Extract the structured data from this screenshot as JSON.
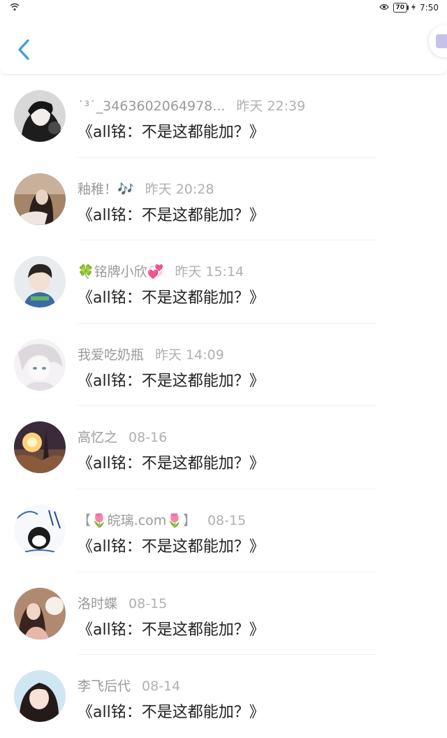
{
  "status_bar": {
    "wifi_icon": "wifi-icon",
    "eye_icon": "eye-icon",
    "battery": "70",
    "time": "7:50"
  },
  "header": {
    "back_icon": "chevron-left-icon",
    "accent_color": "#3a9de1"
  },
  "items": [
    {
      "name": "˙³˙_3463602064978...",
      "time": "昨天 22:39",
      "message": "《all铭：不是这都能加？》"
    },
    {
      "name": "釉稚！🎶",
      "time": "昨天 20:28",
      "message": "《all铭：不是这都能加？》"
    },
    {
      "name": "🍀铭牌小欣💞",
      "time": "昨天 15:14",
      "message": "《all铭：不是这都能加？》"
    },
    {
      "name": "我爱吃奶瓶",
      "time": "昨天 14:09",
      "message": "《all铭：不是这都能加？》"
    },
    {
      "name": "高忆之",
      "time": "08-16",
      "message": "《all铭：不是这都能加？》"
    },
    {
      "name": "【🌷皖璃.com🌷】",
      "time": "08-15",
      "message": "《all铭：不是这都能加？》"
    },
    {
      "name": "洛时蝶",
      "time": "08-15",
      "message": "《all铭：不是这都能加？》"
    },
    {
      "name": "李飞后代",
      "time": "08-14",
      "message": "《all铭：不是这都能加？》"
    }
  ]
}
